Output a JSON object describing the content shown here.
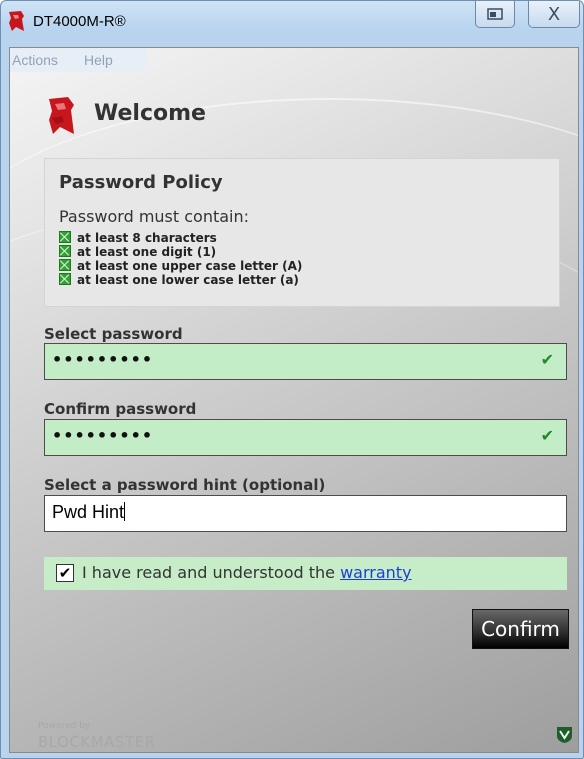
{
  "window": {
    "title": "DT4000M-R®",
    "restore_icon": "restore-window-icon",
    "close_glyph": "X"
  },
  "menu": {
    "items": [
      {
        "label": "Actions"
      },
      {
        "label": "Help"
      }
    ]
  },
  "welcome": {
    "title": "Welcome",
    "logo_icon": "kingston-logo-icon"
  },
  "policy": {
    "title": "Password Policy",
    "intro": "Password must contain:",
    "rules": [
      {
        "label": "at least 8 characters",
        "met": true
      },
      {
        "label": "at least one digit (1)",
        "met": true
      },
      {
        "label": "at least one upper case letter (A)",
        "met": true
      },
      {
        "label": "at least one lower case letter (a)",
        "met": true
      }
    ]
  },
  "form": {
    "select_password": {
      "label": "Select password",
      "masked_value": "•••••••••",
      "valid": true
    },
    "confirm_password": {
      "label": "Confirm password",
      "masked_value": "•••••••••",
      "valid": true
    },
    "hint": {
      "label": "Select a password hint (optional)",
      "value": "Pwd Hint"
    },
    "valid_mark": "✔"
  },
  "warranty": {
    "checked": true,
    "check_glyph": "✔",
    "text": "I have read and understood the ",
    "link": "warranty"
  },
  "actions": {
    "confirm_label": "Confirm"
  },
  "footer": {
    "powered_by": "Powered by",
    "brand": "BLOCKMASTER",
    "shield_icon": "shield-icon"
  },
  "colors": {
    "valid_field_bg": "#c3edc6",
    "brand_red": "#c8161d",
    "link_blue": "#1b3fd6"
  }
}
